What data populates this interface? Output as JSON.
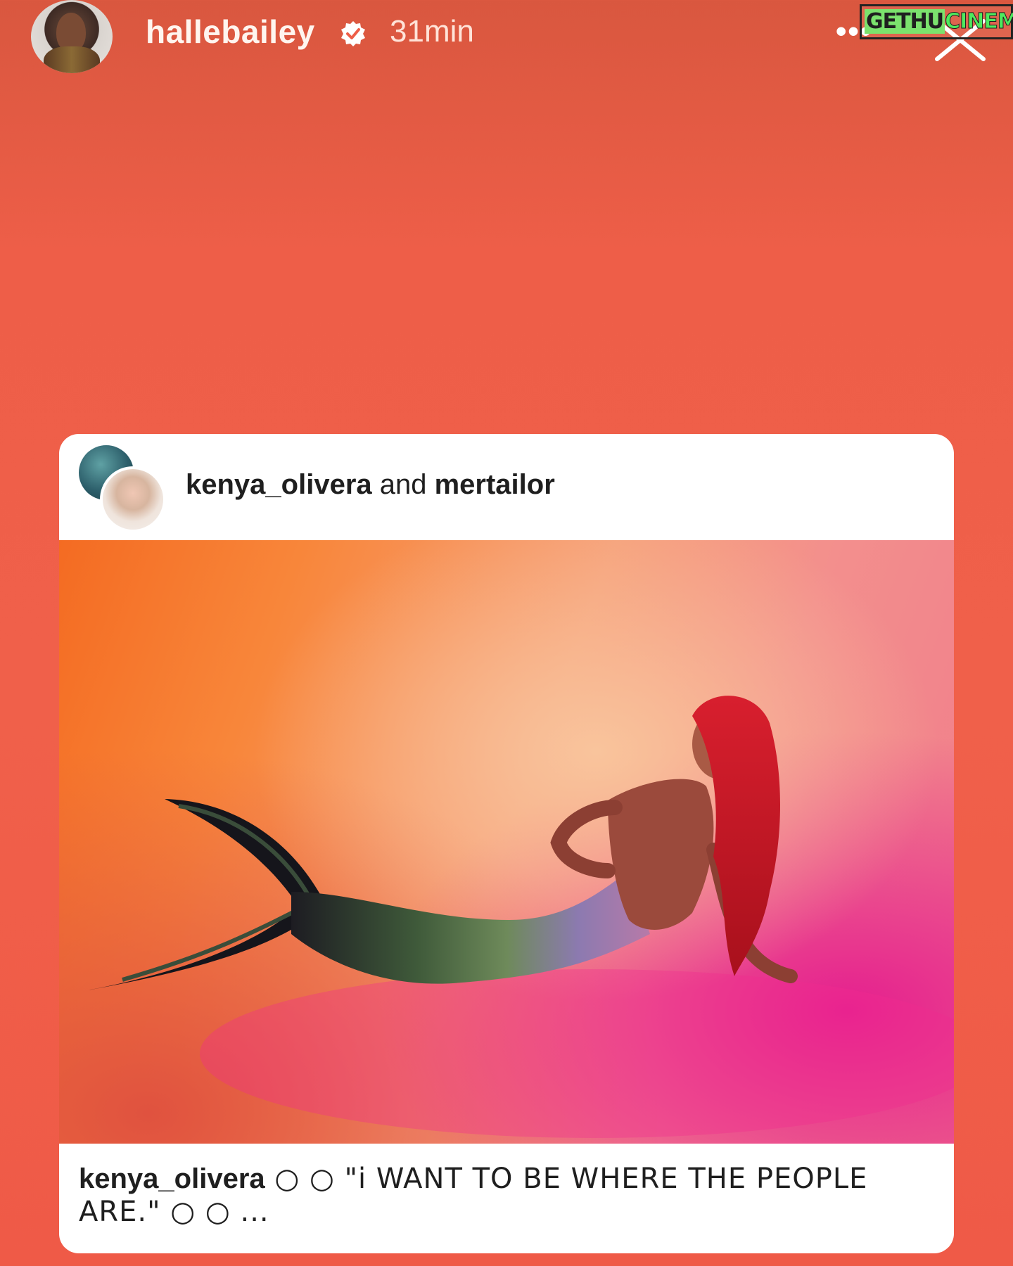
{
  "story": {
    "username": "hallebailey",
    "verified_icon": "verified-badge-icon",
    "time": "31min",
    "more_label": "•••",
    "close_icon": "close-icon"
  },
  "watermark": {
    "part1": "GETHU",
    "part2": "CINEMA"
  },
  "card": {
    "collab_user1": "kenya_olivera",
    "collab_joiner": " and ",
    "collab_user2": "mertailor",
    "caption_user": "kenya_olivera",
    "caption_text": " ○ ○ \"i WANT TO BE WHERE THE PEOPLE ARE.\" ○ ○ ..."
  },
  "colors": {
    "background": "#ef5f48",
    "card": "#ffffff",
    "text": "#1f1f1f"
  }
}
